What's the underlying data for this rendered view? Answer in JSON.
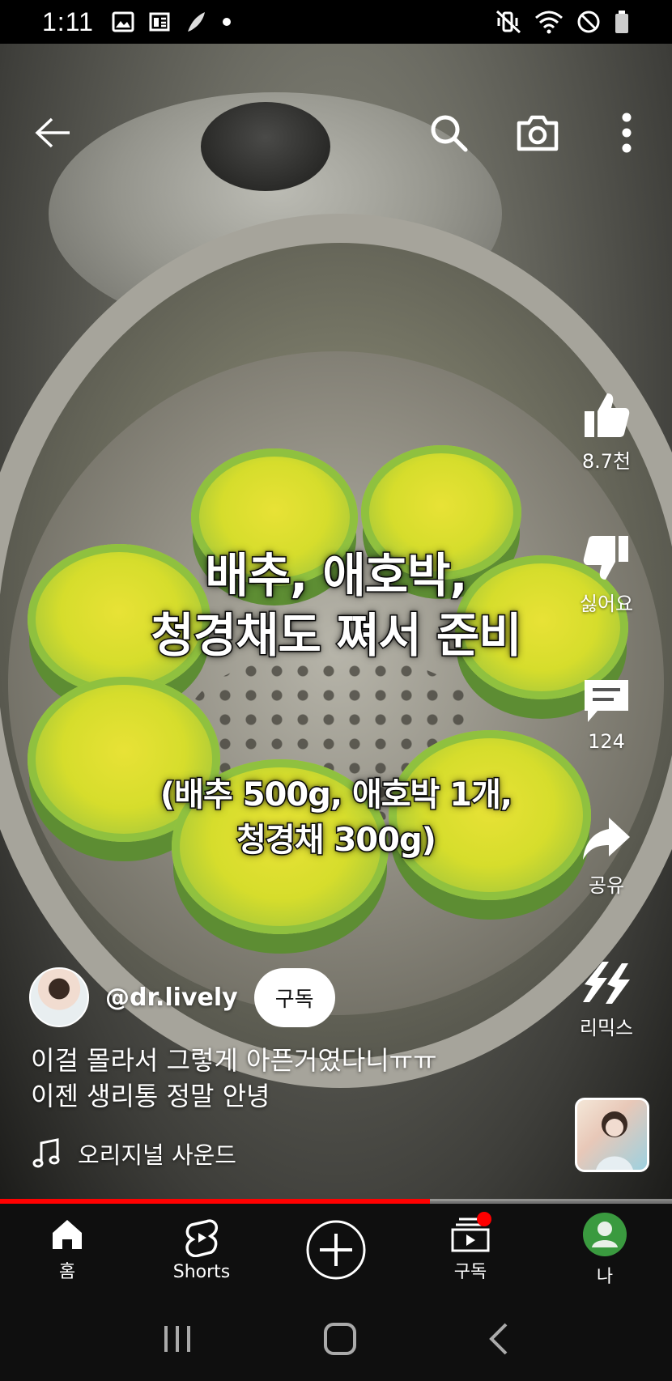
{
  "status_bar": {
    "time": "1:11",
    "left_icons": [
      "image-icon",
      "news-icon",
      "feather-icon",
      "dot-icon"
    ],
    "right_icons": [
      "mute-vibrate-icon",
      "wifi-icon",
      "do-not-disturb-icon",
      "battery-icon"
    ]
  },
  "top_bar": {
    "icons": [
      "back-arrow-icon",
      "search-icon",
      "camera-icon",
      "more-vert-icon"
    ]
  },
  "video": {
    "overlay_title_line1": "배추, 애호박,",
    "overlay_title_line2": "청경채도 쪄서 준비",
    "overlay_sub_line1": "(배추 500g, 애호박 1개,",
    "overlay_sub_line2": "청경채 300g)"
  },
  "rail": {
    "like_count": "8.7천",
    "dislike_label": "싫어요",
    "comment_count": "124",
    "share_label": "공유",
    "remix_label": "리믹스"
  },
  "channel": {
    "handle": "@dr.lively",
    "subscribe_label": "구독"
  },
  "caption": {
    "line1": "이걸 몰라서 그렇게 아픈거였다니ㅠㅠ",
    "line2": "이젠 생리통 정말 안녕"
  },
  "sound": {
    "label": "오리지널 사운드"
  },
  "progress": {
    "played_fraction": 0.64
  },
  "bottom_nav": {
    "home": "홈",
    "shorts": "Shorts",
    "subscriptions": "구독",
    "you": "나"
  },
  "colors": {
    "accent_red": "#ff0000",
    "nav_bg": "#0f0f0f",
    "profile_green": "#3a9a3f"
  }
}
